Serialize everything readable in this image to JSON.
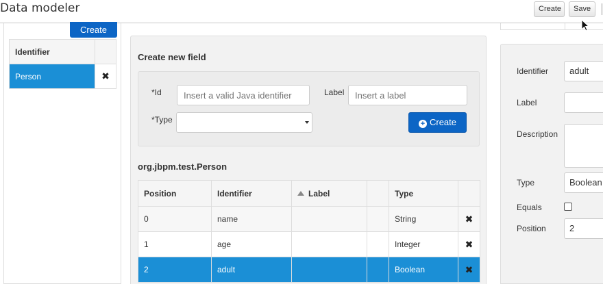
{
  "app": {
    "title": "Data modeler"
  },
  "toolbar": {
    "create_label": "Create",
    "save_label": "Save"
  },
  "left": {
    "create_label": "Create",
    "table_header": "Identifier",
    "rows": [
      {
        "identifier": "Person",
        "selected": true
      }
    ]
  },
  "form": {
    "title": "Create new field",
    "id_label": "*Id",
    "id_placeholder": "Insert a valid Java identifier",
    "label_label": "Label",
    "label_placeholder": "Insert a label",
    "type_label": "*Type",
    "type_value": "",
    "create_label": "Create"
  },
  "fields": {
    "class_name": "org.jbpm.test.Person",
    "headers": {
      "position": "Position",
      "identifier": "Identifier",
      "label": "Label",
      "type": "Type"
    },
    "rows": [
      {
        "position": "0",
        "identifier": "name",
        "label": "",
        "type": "String"
      },
      {
        "position": "1",
        "identifier": "age",
        "label": "",
        "type": "Integer"
      },
      {
        "position": "2",
        "identifier": "adult",
        "label": "",
        "type": "Boolean"
      }
    ],
    "selected_row": 2
  },
  "properties": {
    "identifier_label": "Identifier",
    "identifier_value": "adult",
    "label_label": "Label",
    "label_value": "",
    "description_label": "Description",
    "description_value": "",
    "type_label": "Type",
    "type_value": "Boolean",
    "equals_label": "Equals",
    "equals_checked": false,
    "position_label": "Position",
    "position_value": "2"
  },
  "icons": {
    "delete": "times-icon",
    "sort": "sort-up-icon",
    "add": "plus-circle-icon",
    "cursor": "mouse-pointer-icon"
  },
  "colors": {
    "primary": "#0c65c5",
    "selection": "#1b8fd6"
  }
}
